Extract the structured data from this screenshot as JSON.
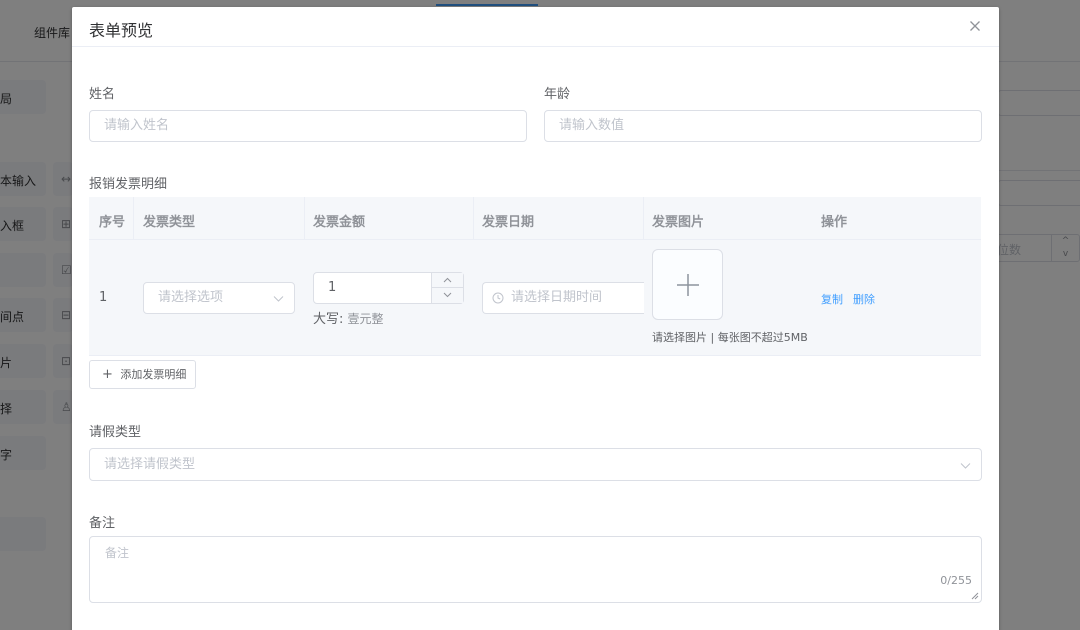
{
  "background": {
    "tab_label": "组件库",
    "left_items": [
      "局",
      "本输入",
      "入框",
      "",
      "间点",
      "片",
      "择",
      "字",
      ""
    ],
    "right_items": [
      "↔",
      "⊞",
      "☑",
      "⊟",
      "⊡",
      "♙"
    ],
    "number_placeholder": "位数"
  },
  "dialog": {
    "title": "表单预览",
    "close_icon": "close-icon"
  },
  "form": {
    "name": {
      "label": "姓名",
      "placeholder": "请输入姓名"
    },
    "age": {
      "label": "年龄",
      "placeholder": "请输入数值"
    },
    "invoice": {
      "label": "报销发票明细",
      "columns": [
        "序号",
        "发票类型",
        "发票金额",
        "发票日期",
        "发票图片",
        "操作"
      ],
      "rows": [
        {
          "index": "1",
          "type_placeholder": "请选择选项",
          "amount": "1",
          "upper_label": "大写:",
          "upper_value": "壹元整",
          "date_placeholder": "请选择日期时间",
          "image_tip": "请选择图片 | 每张图不超过5MB",
          "actions": [
            "复制",
            "删除"
          ]
        }
      ],
      "add_button": "添加发票明细"
    },
    "leave": {
      "label": "请假类型",
      "placeholder": "请选择请假类型"
    },
    "remark": {
      "label": "备注",
      "placeholder": "备注",
      "count": "0/255"
    }
  },
  "colors": {
    "primary": "#409eff",
    "border": "#dcdfe6",
    "placeholder": "#c0c4cc",
    "text": "#606266",
    "header_bg": "#f5f7fa"
  }
}
